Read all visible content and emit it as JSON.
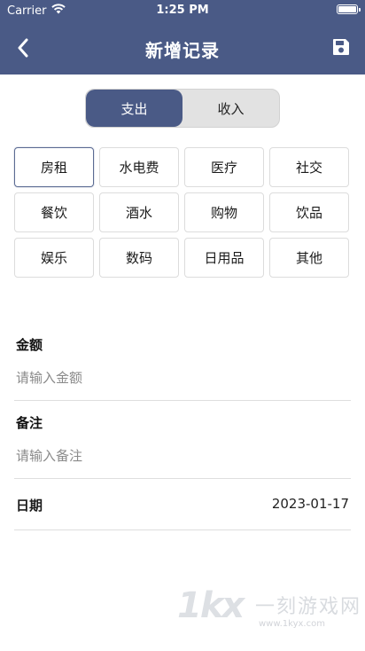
{
  "status_bar": {
    "carrier": "Carrier",
    "time": "1:25 PM"
  },
  "nav": {
    "title": "新增记录",
    "back_icon": "chevron-left-icon",
    "save_icon": "floppy-disk-icon"
  },
  "segment": {
    "options": [
      {
        "label": "支出",
        "active": true
      },
      {
        "label": "收入",
        "active": false
      }
    ]
  },
  "categories": [
    {
      "label": "房租",
      "selected": true
    },
    {
      "label": "水电费"
    },
    {
      "label": "医疗"
    },
    {
      "label": "社交"
    },
    {
      "label": "餐饮"
    },
    {
      "label": "酒水"
    },
    {
      "label": "购物"
    },
    {
      "label": "饮品"
    },
    {
      "label": "娱乐"
    },
    {
      "label": "数码"
    },
    {
      "label": "日用品"
    },
    {
      "label": "其他"
    }
  ],
  "form": {
    "amount": {
      "label": "金额",
      "value": "",
      "placeholder": "请输入金额"
    },
    "note": {
      "label": "备注",
      "value": "",
      "placeholder": "请输入备注"
    },
    "date": {
      "label": "日期",
      "value": "2023-01-17"
    }
  },
  "watermark": {
    "logo": "1kx",
    "text": "一刻游戏网",
    "url": "www.1kyx.com"
  },
  "colors": {
    "header_bg": "#4a5a86",
    "accent": "#4a5a86",
    "divider": "#dedede"
  }
}
